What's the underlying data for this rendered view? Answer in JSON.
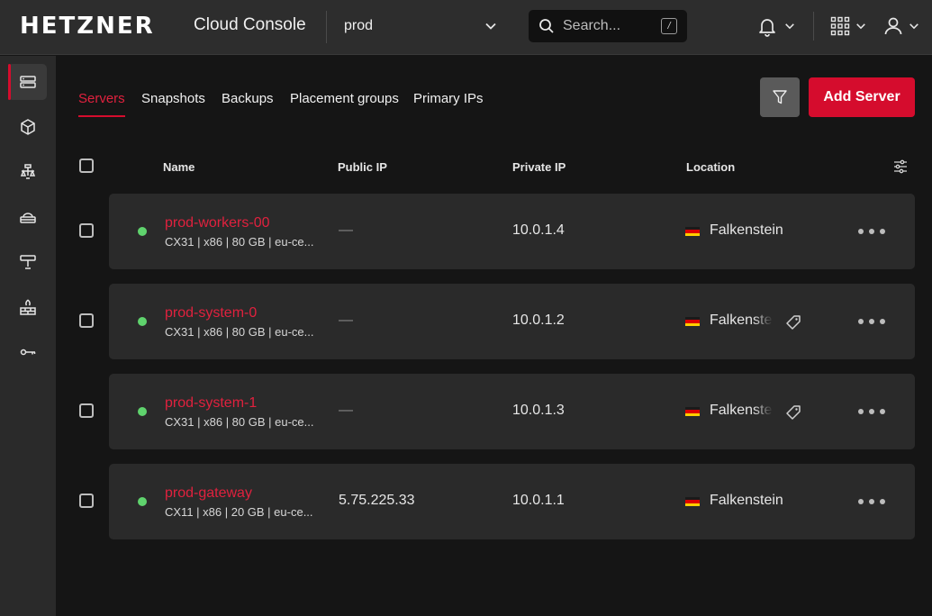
{
  "header": {
    "logo": "HETZNER",
    "title": "Cloud Console",
    "project": "prod",
    "search_placeholder": "Search...",
    "search_shortcut": "/"
  },
  "sidebar": {
    "items": [
      {
        "icon": "servers-icon",
        "active": true
      },
      {
        "icon": "volumes-icon",
        "active": false
      },
      {
        "icon": "load-balancers-icon",
        "active": false
      },
      {
        "icon": "networks-icon",
        "active": false
      },
      {
        "icon": "floating-ips-icon",
        "active": false
      },
      {
        "icon": "firewalls-icon",
        "active": false
      },
      {
        "icon": "security-key-icon",
        "active": false
      }
    ]
  },
  "tabs": [
    {
      "label": "Servers",
      "active": true
    },
    {
      "label": "Snapshots",
      "active": false
    },
    {
      "label": "Backups",
      "active": false
    },
    {
      "label": "Placement groups",
      "active": false
    },
    {
      "label": "Primary IPs",
      "active": false
    }
  ],
  "toolbar": {
    "add_label": "Add Server"
  },
  "table": {
    "headers": {
      "name": "Name",
      "public_ip": "Public IP",
      "private_ip": "Private IP",
      "location": "Location"
    },
    "rows": [
      {
        "name": "prod-workers-00",
        "specs": "CX31 | x86 | 80 GB | eu-ce...",
        "public_ip": "—",
        "private_ip": "10.0.1.4",
        "location": "Falkenstein",
        "has_label": false,
        "status": "running"
      },
      {
        "name": "prod-system-0",
        "specs": "CX31 | x86 | 80 GB | eu-ce...",
        "public_ip": "—",
        "private_ip": "10.0.1.2",
        "location": "Falkenstein",
        "has_label": true,
        "status": "running"
      },
      {
        "name": "prod-system-1",
        "specs": "CX31 | x86 | 80 GB | eu-ce...",
        "public_ip": "—",
        "private_ip": "10.0.1.3",
        "location": "Falkenstein",
        "has_label": true,
        "status": "running"
      },
      {
        "name": "prod-gateway",
        "specs": "CX11 | x86 | 20 GB | eu-ce...",
        "public_ip": "5.75.225.33",
        "private_ip": "10.0.1.1",
        "location": "Falkenstein",
        "has_label": false,
        "status": "running"
      }
    ]
  },
  "colors": {
    "accent": "#d50c2d",
    "status_running": "#5fd36d",
    "background": "#151515",
    "topbar": "#2d2d2d",
    "row": "#2a2a2a"
  }
}
